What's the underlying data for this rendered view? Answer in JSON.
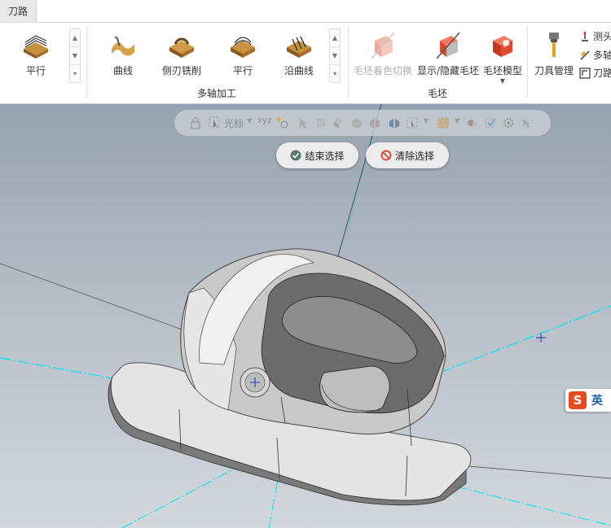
{
  "tabs": [
    {
      "label": "刀路"
    }
  ],
  "ribbon": {
    "left_group": {
      "button": "平行"
    },
    "multiaxis_group": {
      "label": "多轴加工",
      "buttons": [
        "曲线",
        "侧刃铣削",
        "平行",
        "沿曲线"
      ]
    },
    "blank_group": {
      "label": "毛坯",
      "buttons": [
        "毛坯着色切换",
        "显示/隐藏毛坯",
        "毛坯模型"
      ]
    },
    "tool_group": {
      "button": "刀具管理",
      "small_items": [
        "测头",
        "多轴",
        "刀路"
      ]
    }
  },
  "viewport": {
    "toolbar": {
      "cursor_label": "光标"
    },
    "finish_selection": "结束选择",
    "clear_selection": "清除选择"
  },
  "ime": {
    "char": "英",
    "logo": "S"
  },
  "colors": {
    "accent_cyan": "#00e5ee",
    "model_gray": "#8c8c8c"
  }
}
